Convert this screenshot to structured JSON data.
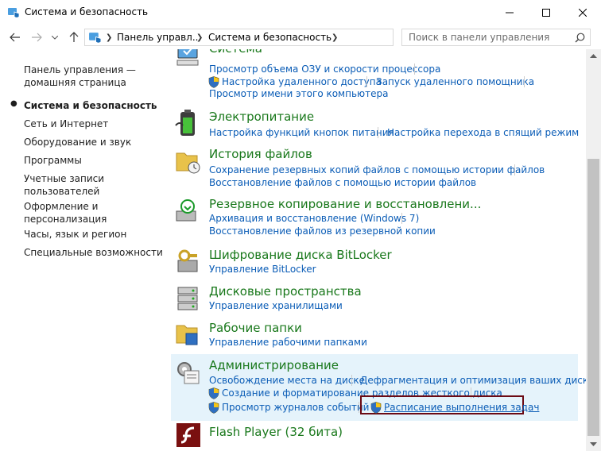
{
  "window": {
    "title": "Система и безопасность"
  },
  "address": {
    "segments": [
      "Панель управл...",
      "Система и безопасность"
    ],
    "search_placeholder": "Поиск в панели управления"
  },
  "sidebar": {
    "items": [
      {
        "label": "Панель управления —\nдомашняя страница",
        "current": false
      },
      {
        "label": "Система и безопасность",
        "current": true
      },
      {
        "label": "Сеть и Интернет",
        "current": false
      },
      {
        "label": "Оборудование и звук",
        "current": false
      },
      {
        "label": "Программы",
        "current": false
      },
      {
        "label": "Учетные записи\nпользователей",
        "current": false
      },
      {
        "label": "Оформление и\nперсонализация",
        "current": false
      },
      {
        "label": "Часы, язык и регион",
        "current": false
      },
      {
        "label": "Специальные возможности",
        "current": false
      }
    ]
  },
  "categories": [
    {
      "title": "Система",
      "icon": "system-monitor-icon",
      "links": [
        "Просмотр объема ОЗУ и скорости процессора",
        "Настройка удаленного доступа",
        "Запуск удаленного помощника",
        "Просмотр имени этого компьютера"
      ]
    },
    {
      "title": "Электропитание",
      "icon": "battery-icon",
      "links": [
        "Настройка функций кнопок питания",
        "Настройка перехода в спящий режим"
      ]
    },
    {
      "title": "История файлов",
      "icon": "file-history-icon",
      "links": [
        "Сохранение резервных копий файлов с помощью истории файлов",
        "Восстановление файлов с помощью истории файлов"
      ]
    },
    {
      "title": "Резервное копирование и восстановлени...",
      "icon": "backup-restore-icon",
      "links": [
        "Архивация и восстановление (Windows 7)",
        "Восстановление файлов из резервной копии"
      ]
    },
    {
      "title": "Шифрование диска BitLocker",
      "icon": "bitlocker-icon",
      "links": [
        "Управление BitLocker"
      ]
    },
    {
      "title": "Дисковые пространства",
      "icon": "storage-spaces-icon",
      "links": [
        "Управление хранилищами"
      ]
    },
    {
      "title": "Рабочие папки",
      "icon": "work-folders-icon",
      "links": [
        "Управление рабочими папками"
      ]
    },
    {
      "title": "Администрирование",
      "icon": "administrative-tools-icon",
      "links": [
        "Освобождение места на диске",
        "Дефрагментация и оптимизация ваших дисков",
        "Создание и форматирование разделов жесткого диска",
        "Просмотр журналов событий",
        "Расписание выполнения задач"
      ]
    },
    {
      "title": "Flash Player (32 бита)",
      "icon": "flash-player-icon",
      "links": []
    }
  ],
  "colors": {
    "category_title": "#19781b",
    "link": "#0a5cb6",
    "highlight_bg": "#e5f3fb",
    "focus_border": "#6b0a14"
  }
}
